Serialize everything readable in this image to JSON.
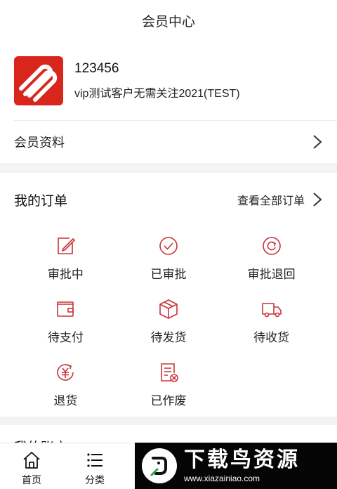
{
  "header": {
    "title": "会员中心"
  },
  "profile": {
    "user_id": "123456",
    "description": "vip测试客户无需关注2021(TEST)"
  },
  "member_info": {
    "label": "会员资料"
  },
  "orders": {
    "title": "我的订单",
    "view_all": "查看全部订单",
    "items": [
      {
        "label": "审批中",
        "icon": "edit-icon"
      },
      {
        "label": "已审批",
        "icon": "check-circle-icon"
      },
      {
        "label": "审批退回",
        "icon": "return-circle-icon"
      },
      {
        "label": "待支付",
        "icon": "wallet-icon"
      },
      {
        "label": "待发货",
        "icon": "package-icon"
      },
      {
        "label": "待收货",
        "icon": "truck-icon"
      },
      {
        "label": "退货",
        "icon": "refund-yen-icon"
      },
      {
        "label": "已作废",
        "icon": "document-cancel-icon"
      }
    ]
  },
  "account": {
    "title": "我的账户"
  },
  "tabbar": {
    "items": [
      {
        "label": "首页",
        "icon": "home-icon"
      },
      {
        "label": "分类",
        "icon": "list-icon"
      }
    ]
  },
  "watermark": {
    "title": "下载鸟资源",
    "url": "www.xiazainiao.com"
  },
  "colors": {
    "accent": "#d9261c",
    "icon_red": "#c9333a",
    "divider": "#f3f3f3"
  }
}
